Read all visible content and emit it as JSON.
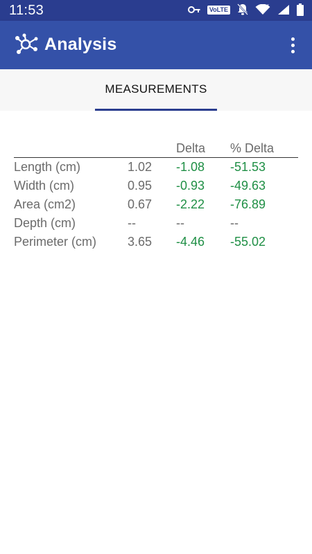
{
  "status_bar": {
    "time": "11:53",
    "volte": "VoLTE",
    "icons": [
      "key-icon",
      "volte-icon",
      "bell-off-icon",
      "wifi-icon",
      "signal-icon",
      "battery-icon"
    ]
  },
  "app_bar": {
    "title": "Analysis",
    "icons": [
      "app-logo-icon",
      "overflow-menu-icon"
    ]
  },
  "tabs": [
    {
      "label": "MEASUREMENTS",
      "selected": true
    }
  ],
  "measurements": {
    "headers": {
      "name": "",
      "value": "",
      "delta": "Delta",
      "pct_delta": "% Delta"
    },
    "rows": [
      {
        "name": "Length (cm)",
        "value": "1.02",
        "delta": "-1.08",
        "pct_delta": "-51.53"
      },
      {
        "name": "Width (cm)",
        "value": "0.95",
        "delta": "-0.93",
        "pct_delta": "-49.63"
      },
      {
        "name": "Area (cm2)",
        "value": "0.67",
        "delta": "-2.22",
        "pct_delta": "-76.89"
      },
      {
        "name": "Depth (cm)",
        "value": "--",
        "delta": "--",
        "pct_delta": "--"
      },
      {
        "name": "Perimeter (cm)",
        "value": "3.65",
        "delta": "-4.46",
        "pct_delta": "-55.02"
      }
    ]
  },
  "colors": {
    "status_bar": "#2a3d8f",
    "app_bar": "#3451a8",
    "tab_indicator": "#2a3d8f",
    "delta_green": "#1f8f45",
    "label_gray": "#6b6b6b"
  }
}
